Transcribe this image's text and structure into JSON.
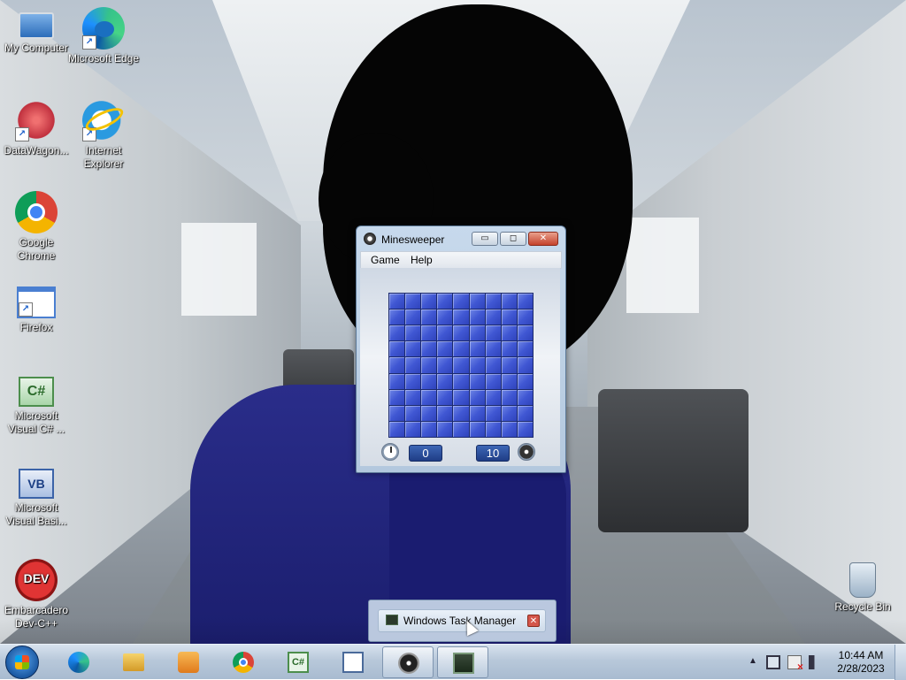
{
  "desktop": {
    "icons": [
      {
        "label": "My Computer",
        "icon": "computer-icon"
      },
      {
        "label": "Microsoft Edge",
        "icon": "edge-icon"
      },
      {
        "label": "DataWagon...",
        "icon": "datawagon-icon"
      },
      {
        "label": "Internet Explorer",
        "icon": "internet-explorer-icon"
      },
      {
        "label": "Google Chrome",
        "icon": "chrome-icon"
      },
      {
        "label": "Firefox",
        "icon": "window-icon"
      },
      {
        "label": "Microsoft Visual C# ...",
        "icon": "csharp-icon"
      },
      {
        "label": "Microsoft Visual Basi...",
        "icon": "visual-basic-icon"
      },
      {
        "label": "Embarcadero Dev-C++",
        "icon": "devcpp-icon"
      },
      {
        "label": "Recycle Bin",
        "icon": "recycle-bin-icon"
      }
    ],
    "icon_glyphs": {
      "csharp": "C#",
      "vb": "VB",
      "devcpp": "DEV"
    }
  },
  "minesweeper": {
    "title": "Minesweeper",
    "menu": [
      "Game",
      "Help"
    ],
    "caption_buttons": {
      "minimize": "▭",
      "maximize": "◻",
      "close": "✕"
    },
    "grid": {
      "rows": 9,
      "cols": 9
    },
    "time": "0",
    "mines": "10"
  },
  "taskbar_popup": {
    "label": "Windows Task Manager",
    "close": "✕"
  },
  "taskbar": {
    "buttons": [
      {
        "name": "edge",
        "icon": "edge-icon",
        "active": false
      },
      {
        "name": "explorer",
        "icon": "folder-icon",
        "active": false
      },
      {
        "name": "media-player",
        "icon": "media-player-icon",
        "active": false
      },
      {
        "name": "chrome",
        "icon": "chrome-icon",
        "active": false
      },
      {
        "name": "visual-csharp",
        "icon": "csharp-icon",
        "active": false
      },
      {
        "name": "document",
        "icon": "document-icon",
        "active": false
      },
      {
        "name": "minesweeper",
        "icon": "minesweeper-icon",
        "active": true
      },
      {
        "name": "task-manager",
        "icon": "task-manager-icon",
        "active": true
      }
    ],
    "csharp_glyph": "C#",
    "tray_arrow": "▲",
    "clock": {
      "time": "10:44 AM",
      "date": "2/28/2023"
    }
  }
}
